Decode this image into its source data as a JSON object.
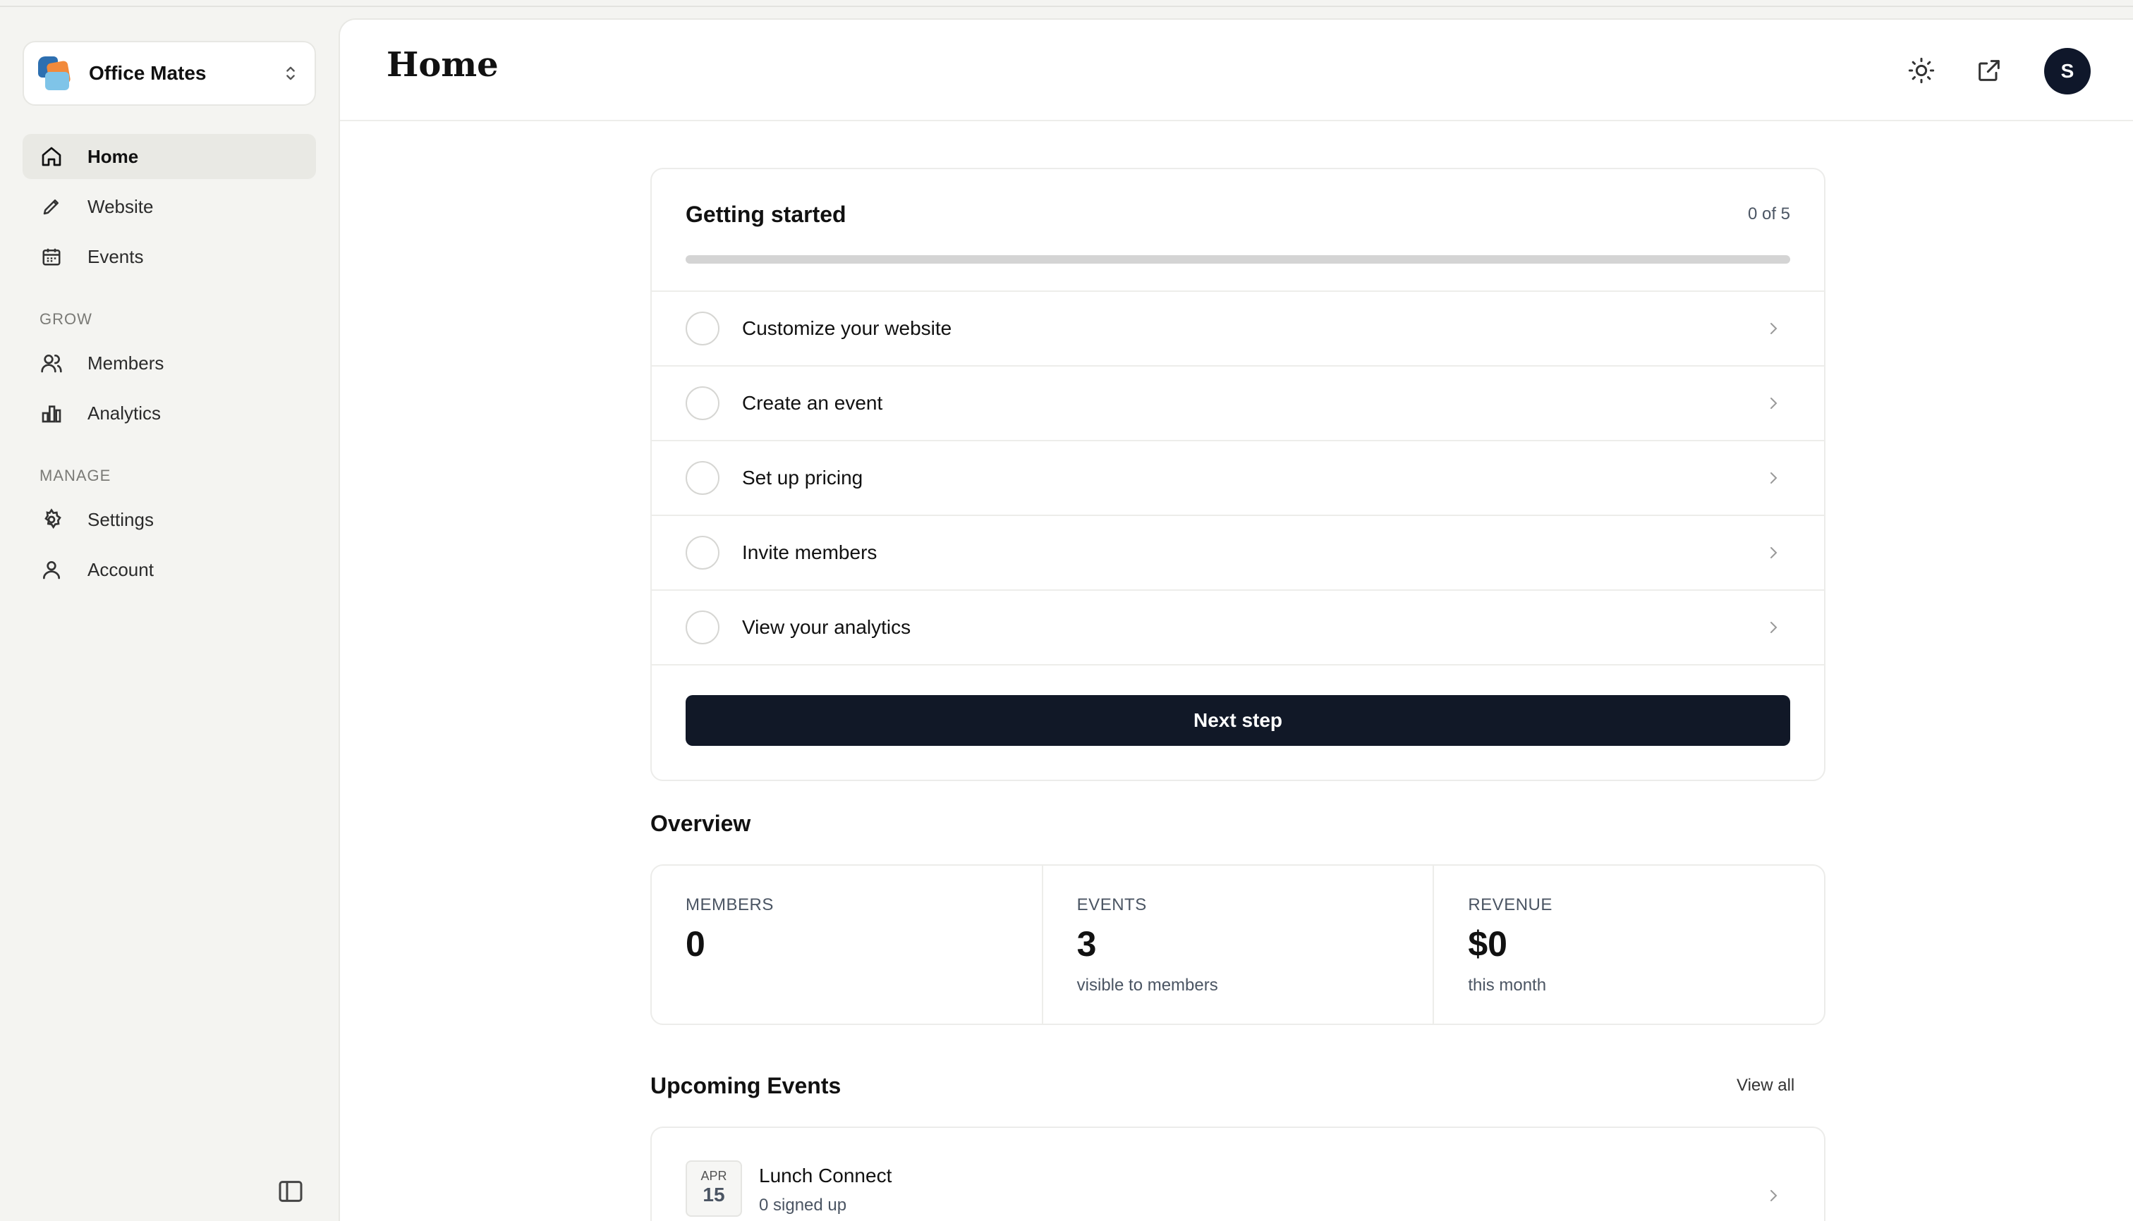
{
  "org": {
    "name": "Office Mates"
  },
  "sidebar": {
    "items": [
      {
        "label": "Home",
        "icon": "home-icon",
        "active": true
      },
      {
        "label": "Website",
        "icon": "pencil-icon"
      },
      {
        "label": "Events",
        "icon": "calendar-icon"
      }
    ],
    "grow": {
      "title": "GROW",
      "items": [
        {
          "label": "Members",
          "icon": "users-icon"
        },
        {
          "label": "Analytics",
          "icon": "bar-chart-icon"
        }
      ]
    },
    "manage": {
      "title": "MANAGE",
      "items": [
        {
          "label": "Settings",
          "icon": "gear-icon"
        },
        {
          "label": "Account",
          "icon": "user-icon"
        }
      ]
    }
  },
  "header": {
    "title": "Home",
    "avatar_initial": "S"
  },
  "getting_started": {
    "title": "Getting started",
    "count": "0 of 5",
    "progress_fraction": 0,
    "tasks": [
      "Customize your website",
      "Create an event",
      "Set up pricing",
      "Invite members",
      "View your analytics"
    ],
    "next_label": "Next step"
  },
  "overview": {
    "title": "Overview",
    "stats": [
      {
        "label": "MEMBERS",
        "value": "0",
        "sub": ""
      },
      {
        "label": "EVENTS",
        "value": "3",
        "sub": "visible to members"
      },
      {
        "label": "REVENUE",
        "value": "$0",
        "sub": "this month"
      }
    ]
  },
  "upcoming": {
    "title": "Upcoming Events",
    "view_all": "View all",
    "events": [
      {
        "month": "APR",
        "day": "15",
        "name": "Lunch Connect",
        "sub": "0 signed up"
      }
    ]
  },
  "colors": {
    "primary": "#111827",
    "sidebar_bg": "#f4f4f1",
    "active_item_bg": "#e9e9e4"
  }
}
